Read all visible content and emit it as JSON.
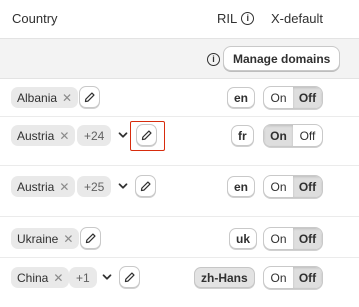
{
  "header": {
    "country": "Country",
    "ril": "RIL",
    "x_default": "X-default"
  },
  "toolbar": {
    "manage_domains": "Manage domains"
  },
  "icons": {
    "info": "info-icon",
    "remove": "close-icon",
    "edit": "pencil-icon",
    "expand": "chevron-down-icon"
  },
  "toggle": {
    "on": "On",
    "off": "Off"
  },
  "rows": [
    {
      "country": "Albania",
      "more": "",
      "language": "en",
      "x_default": "Off"
    },
    {
      "country": "Austria",
      "more": "+24",
      "language": "fr",
      "x_default": "On"
    },
    {
      "country": "Austria",
      "more": "+25",
      "language": "en",
      "x_default": "Off"
    },
    {
      "country": "Ukraine",
      "more": "",
      "language": "uk",
      "x_default": "Off"
    },
    {
      "country": "China",
      "more": "+1",
      "language": "zh-Hans",
      "x_default": "Off"
    }
  ],
  "colors": {
    "focus_ring": "#d72c0d",
    "selected_segment": "#dedede"
  }
}
